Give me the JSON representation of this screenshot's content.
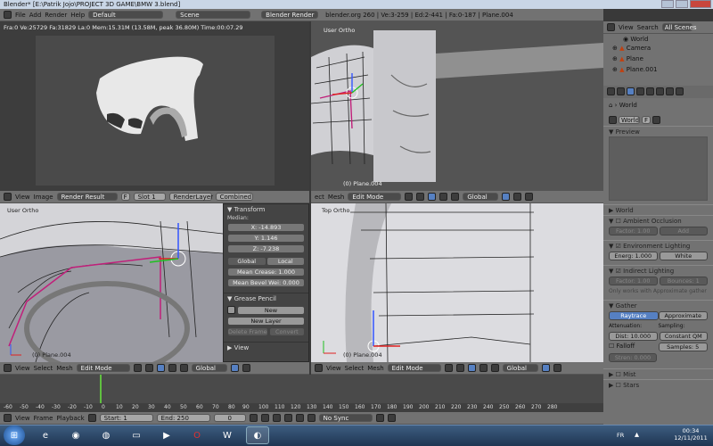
{
  "window": {
    "title": "Blender* [E:\\Patrik Jojo\\PROJECT 3D GAME\\BMW 3.blend]"
  },
  "info_header": {
    "menus": [
      "File",
      "Add",
      "Render",
      "Help"
    ],
    "layout": "Default",
    "scene": "Scene",
    "engine": "Blender Render",
    "stats": "blender.org 260 | Ve:3-259 | Ed:2-441 | Fa:0-187 | Plane.004"
  },
  "uv_area": {
    "status": "Fra:0  Ve:25729 Fa:31829 La:0 Mem:15.31M (13.58M, peak 36.80M) Time:00:07.29",
    "header": {
      "menus": [
        "View",
        "Image"
      ],
      "image": "Render Result",
      "image_flag": "F",
      "slot": "Slot 1",
      "layer": "RenderLayer",
      "pass": "Combined"
    }
  },
  "top_viewport": {
    "label": "User Ortho",
    "object": "(0) Plane.004"
  },
  "bottom_left_viewport": {
    "label": "User Ortho",
    "object": "(0) Plane.004"
  },
  "bottom_right_viewport": {
    "label": "Top Ortho",
    "object": "(0) Plane.004"
  },
  "mesh_header": {
    "menus": [
      "View",
      "Select",
      "Mesh"
    ],
    "menus_top": [
      "ect",
      "Mesh"
    ],
    "mode": "Edit Mode",
    "orientation": "Global"
  },
  "transform_panel": {
    "title": "Transform",
    "median_label": "Median:",
    "x": "X: -14.893",
    "y": "Y: 1.146",
    "z": "Z: -7.238",
    "global": "Global",
    "local": "Local",
    "mean_crease": "Mean Crease: 1.000",
    "mean_bevel": "Mean Bevel Wei: 0.000"
  },
  "grease_panel": {
    "title": "Grease Pencil",
    "new": "New",
    "new_layer": "New Layer",
    "delete_frame": "Delete Frame",
    "convert": "Convert"
  },
  "view_panel": {
    "title": "View"
  },
  "outliner": {
    "menus": [
      "View",
      "Search"
    ],
    "filter": "All Scenes",
    "items": [
      "World",
      "Camera",
      "Plane",
      "Plane.001"
    ]
  },
  "properties": {
    "breadcrumb": "World",
    "world_field": "World",
    "world_flag": "F",
    "sections": {
      "preview": "Preview",
      "world": "World",
      "ambient": "Ambient Occlusion",
      "env": "Environment Lighting",
      "indirect": "Indirect Lighting",
      "gather": "Gather",
      "mist": "Mist",
      "stars": "Stars"
    },
    "ao_factor": "Factor: 1.00",
    "ao_mode": "Add",
    "env_energy": "Energ: 1.000",
    "env_color": "White",
    "ind_factor": "Factor: 1.00",
    "ind_bounces": "Bounces: 1",
    "ind_note": "Only works with Approximate gather",
    "raytrace": "Raytrace",
    "approximate": "Approximate",
    "attenuation": "Attenuation:",
    "sampling": "Sampling:",
    "dist": "Dist: 10.000",
    "const": "Constant QM",
    "falloff": "Falloff",
    "samples": "Samples: 5",
    "strength": "Stren: 0.000"
  },
  "timeline": {
    "ruler": [
      "-60",
      "-40",
      "-20",
      "0",
      "20",
      "40",
      "60",
      "80",
      "100",
      "120",
      "140",
      "160",
      "180",
      "200",
      "220",
      "240",
      "260",
      "280"
    ],
    "ruler2": [
      "-50",
      "-30",
      "-10",
      "10",
      "30",
      "50",
      "70",
      "90",
      "110",
      "130",
      "150",
      "170",
      "190",
      "210",
      "230",
      "250",
      "270"
    ],
    "menus": [
      "View",
      "Frame",
      "Playback"
    ],
    "start": "Start: 1",
    "end": "End: 250",
    "current": "0",
    "sync": "No Sync"
  },
  "taskbar": {
    "lang": "FR",
    "time": "00:34",
    "date": "12/11/2011"
  }
}
